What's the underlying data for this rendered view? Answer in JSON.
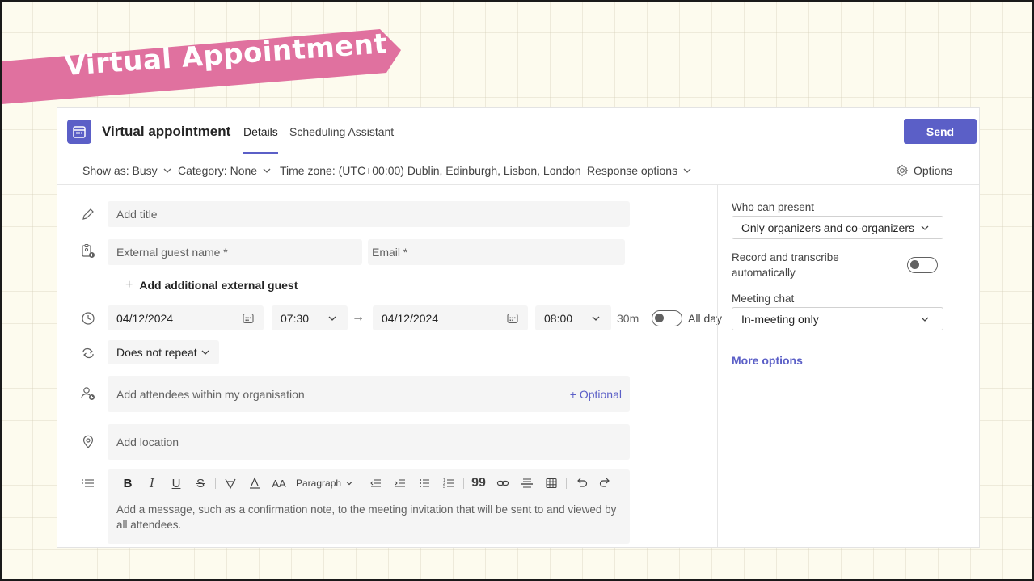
{
  "banner": {
    "text": "Virtual Appointment",
    "color": "#e0719f"
  },
  "header": {
    "title": "Virtual appointment",
    "tabs": [
      {
        "label": "Details",
        "selected": true
      },
      {
        "label": "Scheduling Assistant",
        "selected": false
      }
    ],
    "send_label": "Send",
    "accent": "#5b5fc7"
  },
  "toolbar": {
    "show_as": "Show as: Busy",
    "category": "Category: None",
    "time_zone": "Time zone: (UTC+00:00) Dublin, Edinburgh, Lisbon, London",
    "response_options": "Response options",
    "options": "Options"
  },
  "form": {
    "title_placeholder": "Add title",
    "guest_name_placeholder": "External guest name *",
    "email_placeholder": "Email *",
    "add_guest_label": "Add additional external guest",
    "start_date": "04/12/2024",
    "start_time": "07:30",
    "end_date": "04/12/2024",
    "end_time": "08:00",
    "duration": "30m",
    "all_day_label": "All day",
    "all_day_on": false,
    "repeat": "Does not repeat",
    "attendees_placeholder": "Add attendees within my organisation",
    "optional_label": "+ Optional",
    "location_placeholder": "Add location",
    "paragraph_label": "Paragraph",
    "message_placeholder": "Add a message, such as a confirmation note, to the meeting invitation that will be sent to and viewed by all attendees."
  },
  "side": {
    "who_can_present_label": "Who can present",
    "who_can_present_value": "Only organizers and co-organizers",
    "record_label": "Record and transcribe automatically",
    "record_on": false,
    "meeting_chat_label": "Meeting chat",
    "meeting_chat_value": "In-meeting only",
    "more_options": "More options"
  }
}
